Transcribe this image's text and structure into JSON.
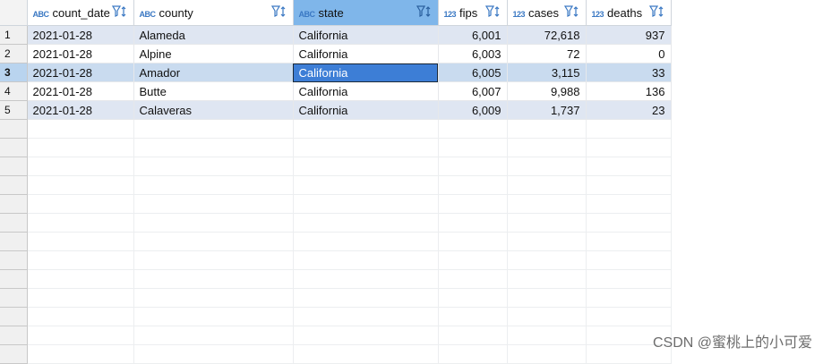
{
  "columns": [
    {
      "type": "ABC",
      "name": "count_date"
    },
    {
      "type": "ABC",
      "name": "county"
    },
    {
      "type": "ABC",
      "name": "state"
    },
    {
      "type": "123",
      "name": "fips"
    },
    {
      "type": "123",
      "name": "cases"
    },
    {
      "type": "123",
      "name": "deaths"
    }
  ],
  "rows": [
    {
      "num": "1",
      "count_date": "2021-01-28",
      "county": "Alameda",
      "state": "California",
      "fips": "6,001",
      "cases": "72,618",
      "deaths": "937"
    },
    {
      "num": "2",
      "count_date": "2021-01-28",
      "county": "Alpine",
      "state": "California",
      "fips": "6,003",
      "cases": "72",
      "deaths": "0"
    },
    {
      "num": "3",
      "count_date": "2021-01-28",
      "county": "Amador",
      "state": "California",
      "fips": "6,005",
      "cases": "3,115",
      "deaths": "33"
    },
    {
      "num": "4",
      "count_date": "2021-01-28",
      "county": "Butte",
      "state": "California",
      "fips": "6,007",
      "cases": "9,988",
      "deaths": "136"
    },
    {
      "num": "5",
      "count_date": "2021-01-28",
      "county": "Calaveras",
      "state": "California",
      "fips": "6,009",
      "cases": "1,737",
      "deaths": "23"
    }
  ],
  "selection": {
    "row": 3,
    "column": "state"
  },
  "watermark": "CSDN @蜜桃上的小可爱",
  "colors": {
    "selected_header": "#7fb6ea",
    "selected_cell": "#3d7ed6",
    "alt_row": "#dfe6f2",
    "type_label": "#3a78c3"
  }
}
